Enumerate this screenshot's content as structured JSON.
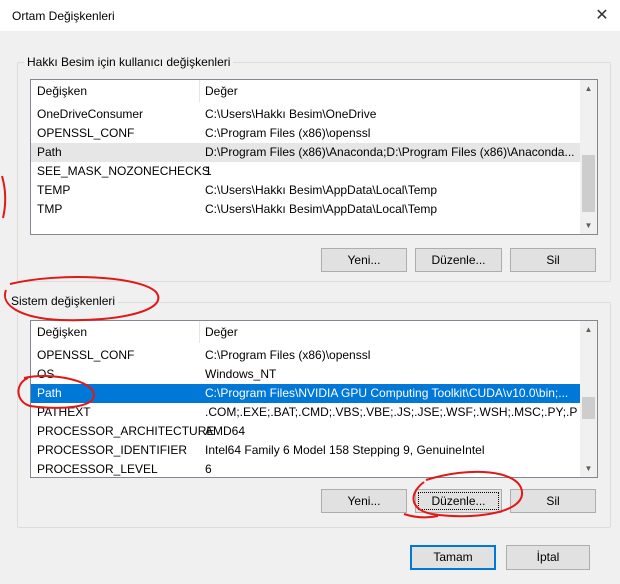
{
  "window": {
    "title": "Ortam Değişkenleri"
  },
  "user_group": {
    "title": "Hakkı Besim için kullanıcı değişkenleri",
    "columns": [
      "Değişken",
      "Değer"
    ],
    "rows": [
      {
        "name": "OneDriveConsumer",
        "value": "C:\\Users\\Hakkı Besim\\OneDrive"
      },
      {
        "name": "OPENSSL_CONF",
        "value": "C:\\Program Files (x86)\\openssl"
      },
      {
        "name": "Path",
        "value": "D:\\Program Files (x86)\\Anaconda;D:\\Program Files (x86)\\Anaconda..."
      },
      {
        "name": "SEE_MASK_NOZONECHECKS",
        "value": "1"
      },
      {
        "name": "TEMP",
        "value": "C:\\Users\\Hakkı Besim\\AppData\\Local\\Temp"
      },
      {
        "name": "TMP",
        "value": "C:\\Users\\Hakkı Besim\\AppData\\Local\\Temp"
      }
    ],
    "buttons": {
      "new": "Yeni...",
      "edit": "Düzenle...",
      "delete": "Sil"
    }
  },
  "system_group": {
    "title": "Sistem değişkenleri",
    "columns": [
      "Değişken",
      "Değer"
    ],
    "rows": [
      {
        "name": "OPENSSL_CONF",
        "value": "C:\\Program Files (x86)\\openssl"
      },
      {
        "name": "OS",
        "value": "Windows_NT"
      },
      {
        "name": "Path",
        "value": "C:\\Program Files\\NVIDIA GPU Computing Toolkit\\CUDA\\v10.0\\bin;..."
      },
      {
        "name": "PATHEXT",
        "value": ".COM;.EXE;.BAT;.CMD;.VBS;.VBE;.JS;.JSE;.WSF;.WSH;.MSC;.PY;.PYW"
      },
      {
        "name": "PROCESSOR_ARCHITECTURE",
        "value": "AMD64"
      },
      {
        "name": "PROCESSOR_IDENTIFIER",
        "value": "Intel64 Family 6 Model 158 Stepping 9, GenuineIntel"
      },
      {
        "name": "PROCESSOR_LEVEL",
        "value": "6"
      }
    ],
    "buttons": {
      "new": "Yeni...",
      "edit": "Düzenle...",
      "delete": "Sil"
    }
  },
  "footer": {
    "ok": "Tamam",
    "cancel": "İptal"
  },
  "colors": {
    "selection": "#0078d7",
    "annotation": "#e01818"
  },
  "icons": {
    "close": "close-icon",
    "scroll_up": "chevron-up-icon",
    "scroll_down": "chevron-down-icon"
  }
}
